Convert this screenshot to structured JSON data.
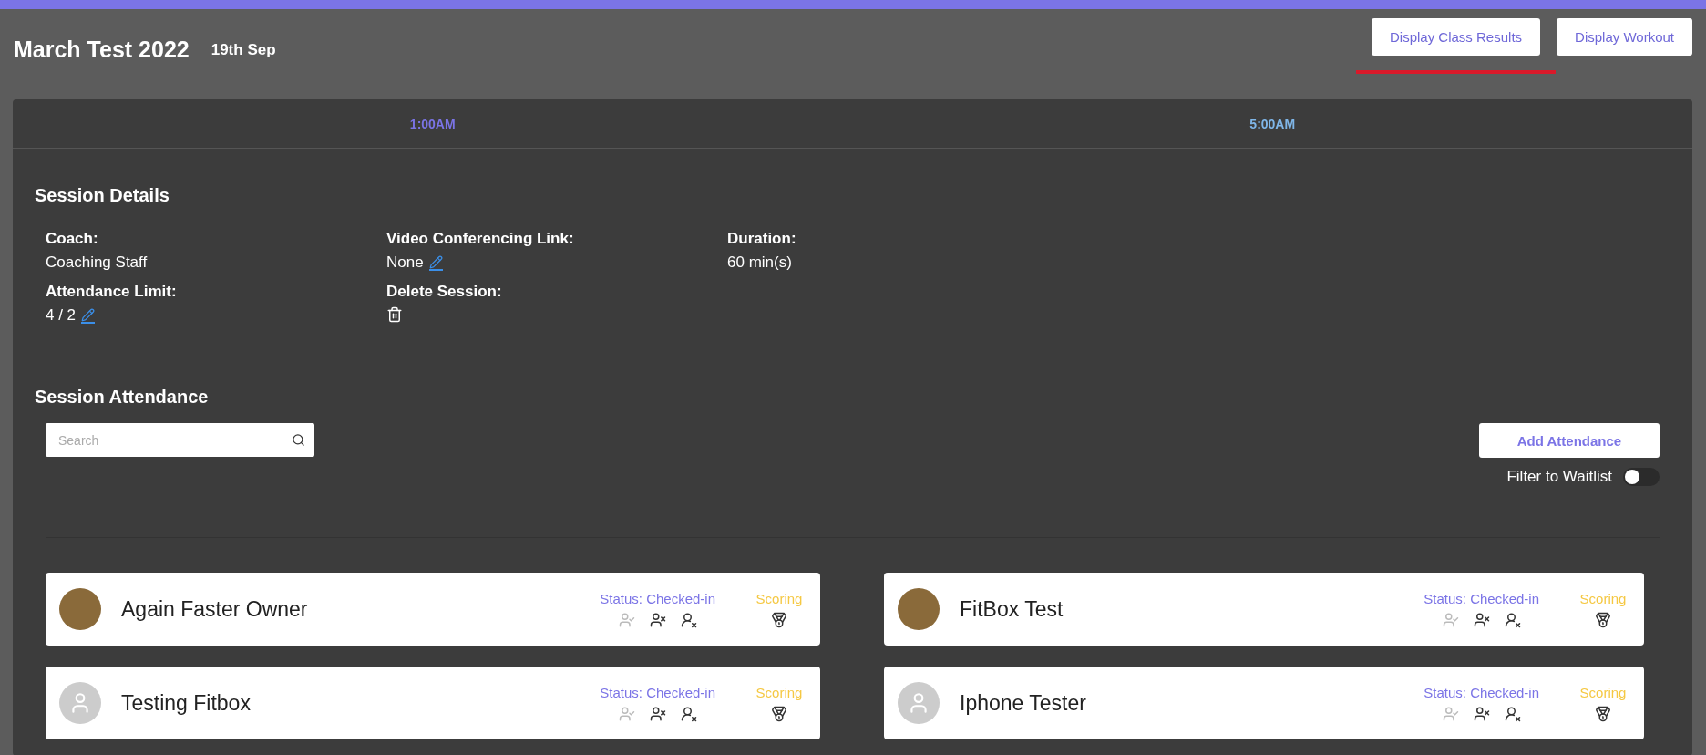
{
  "header": {
    "title": "March Test 2022",
    "date": "19th Sep",
    "buttons": [
      {
        "label": "Display Class Results",
        "selected": true
      },
      {
        "label": "Display Workout",
        "selected": false
      }
    ]
  },
  "time_slots": [
    {
      "label": "1:00AM",
      "selected": true
    },
    {
      "label": "5:00AM",
      "selected": false
    }
  ],
  "session_details": {
    "title": "Session Details",
    "fields": [
      {
        "kind": "text",
        "label": "Coach:",
        "value": "Coaching Staff"
      },
      {
        "kind": "editable",
        "label": "Video Conferencing Link:",
        "value": "None"
      },
      {
        "kind": "text",
        "label": "Duration:",
        "value": "60 min(s)"
      },
      {
        "kind": "editable",
        "label": "Attendance Limit:",
        "value": "4 / 2"
      },
      {
        "kind": "delete",
        "label": "Delete Session:"
      }
    ]
  },
  "attendance": {
    "title": "Session Attendance",
    "search": {
      "placeholder": "Search"
    },
    "add_button": "Add Attendance",
    "filter": {
      "label": "Filter to Waitlist",
      "on": false
    },
    "members": [
      {
        "name": "Again Faster Owner",
        "kind": "photo",
        "status": "Status: Checked-in",
        "scoring": "Scoring"
      },
      {
        "name": "FitBox Test",
        "kind": "photo",
        "status": "Status: Checked-in",
        "scoring": "Scoring"
      },
      {
        "name": "Testing Fitbox",
        "kind": "placeholder",
        "status": "Status: Checked-in",
        "scoring": "Scoring"
      },
      {
        "name": "Iphone Tester",
        "kind": "placeholder",
        "status": "Status: Checked-in",
        "scoring": "Scoring"
      }
    ]
  }
}
